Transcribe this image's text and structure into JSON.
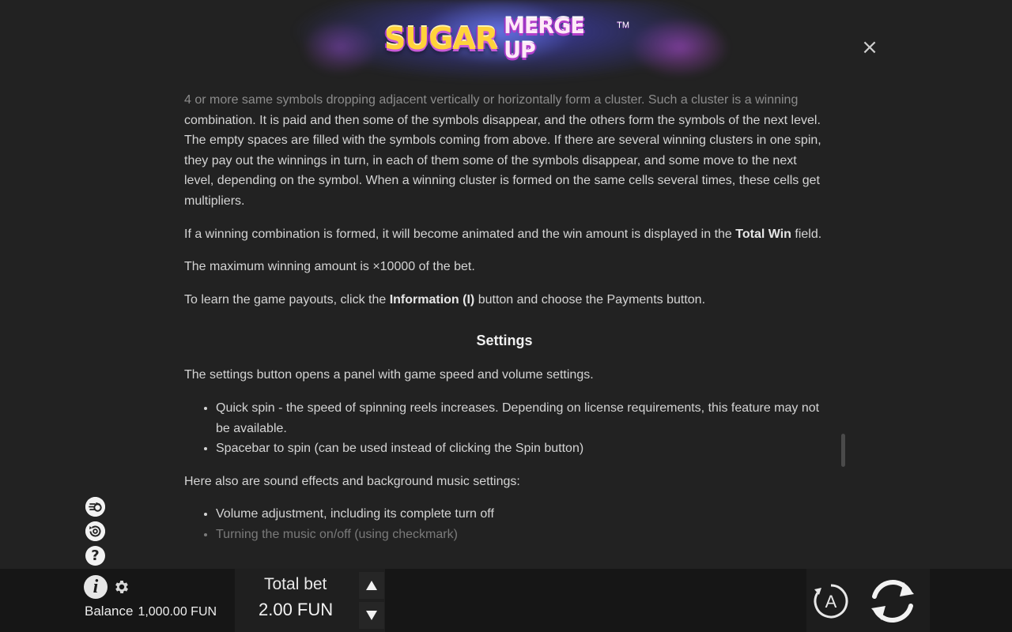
{
  "header": {
    "logo": {
      "word1": "SUGAR",
      "word2": "MERGE UP",
      "tm": "TM"
    },
    "close_label": "×"
  },
  "content": {
    "para_cluster_first_line": "4 or more same symbols dropping adjacent vertically or horizontally form a cluster. Such a cluster is a winning",
    "para_cluster_rest": "combination. It is paid and then some of the symbols disappear, and the others form the symbols of the next level. The empty spaces are filled with the symbols coming from above. If there are several winning clusters in one spin, they pay out the winnings in turn, in each of them some of the symbols disappear, and some move to the next level, depending on the symbol. When a winning cluster is formed on the same cells several times, these cells get multipliers.",
    "para_win_pre": "If a winning combination is formed, it will become animated and the win amount is displayed in the ",
    "para_win_bold": "Total Win",
    "para_win_post": " field.",
    "para_max": "The maximum winning amount is ×10000 of the bet.",
    "para_payouts_pre": "To learn the game payouts, click the ",
    "para_payouts_bold": "Information (I)",
    "para_payouts_post": " button and choose the Payments button.",
    "settings_heading": "Settings",
    "settings_intro": "The settings button opens a panel with game speed and volume settings.",
    "settings_items": [
      "Quick spin - the speed of spinning reels increases. Depending on license requirements, this feature may not be available.",
      "Spacebar to spin (can be used instead of clicking the Spin button)"
    ],
    "sound_intro": "Here also are sound effects and background music settings:",
    "sound_items": [
      "Volume adjustment, including its complete turn off",
      "Turning the music on/off (using checkmark)"
    ]
  },
  "side_icons": [
    "fast-spin-icon",
    "history-icon",
    "help-icon"
  ],
  "help_glyph": "?",
  "bottom": {
    "info_glyph": "i",
    "balance_label": "Balance",
    "balance_value": "1,000.00 FUN",
    "total_bet_label": "Total bet",
    "total_bet_value": "2.00 FUN",
    "auto_glyph": "A"
  },
  "colors": {
    "background": "#222222",
    "bottom_bar": "#161616",
    "text": "#d4d4d4",
    "logo_yellow": "#ffd23a",
    "logo_purple": "#a035c4"
  }
}
